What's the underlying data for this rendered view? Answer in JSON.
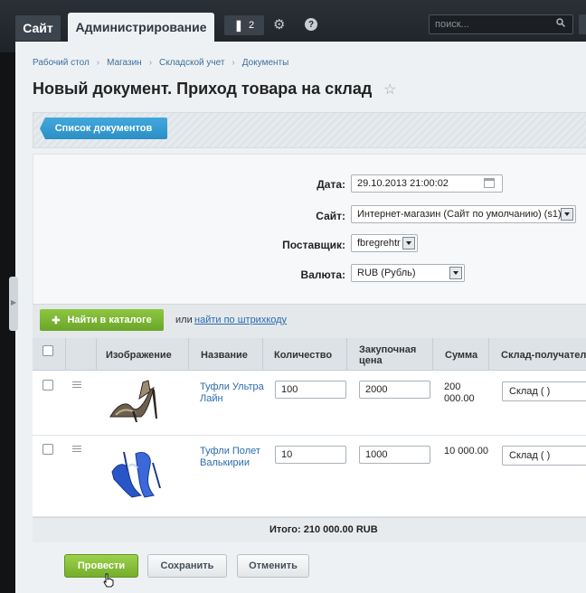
{
  "topbar": {
    "site_tab": "Сайт",
    "admin_tab": "Администрирование",
    "notifications_count": "2",
    "search_placeholder": "поиск..."
  },
  "breadcrumb": [
    "Рабочий стол",
    "Магазин",
    "Складской учет",
    "Документы"
  ],
  "page_title": "Новый документ. Приход товара на склад",
  "toolbar": {
    "list_button": "Список документов"
  },
  "form": {
    "date_label": "Дата:",
    "date_value": "29.10.2013 21:00:02",
    "site_label": "Сайт:",
    "site_value": "Интернет-магазин (Сайт по умолчанию) (s1)",
    "supplier_label": "Поставщик:",
    "supplier_value": "fbregrehtr",
    "currency_label": "Валюта:",
    "currency_value": "RUB (Рубль)"
  },
  "catalog": {
    "find_button": "Найти в каталоге",
    "or_text": "или",
    "barcode_link": "найти по штрихкоду"
  },
  "table": {
    "columns": {
      "image": "Изображение",
      "name": "Название",
      "quantity": "Количество",
      "price_line1": "Закупочная",
      "price_line2": "цена",
      "sum": "Сумма",
      "warehouse": "Склад-получатель"
    },
    "rows": [
      {
        "name_line1": "Туфли Ультра",
        "name_line2": "Лайн",
        "quantity": "100",
        "price": "2000",
        "sum_line1": "200",
        "sum_line2": "000.00",
        "warehouse": "Склад ( )"
      },
      {
        "name_line1": "Туфли Полет",
        "name_line2": "Валькирии",
        "quantity": "10",
        "price": "1000",
        "sum_line1": "10 000.00",
        "sum_line2": "",
        "warehouse": "Склад ( )"
      }
    ]
  },
  "total": "Итого: 210 000.00 RUB",
  "footer": {
    "post_button": "Провести",
    "save_button": "Сохранить",
    "cancel_button": "Отменить"
  },
  "colors": {
    "accent_blue": "#2b8fc5",
    "accent_green": "#74ae2c",
    "link": "#2a6bb0"
  }
}
